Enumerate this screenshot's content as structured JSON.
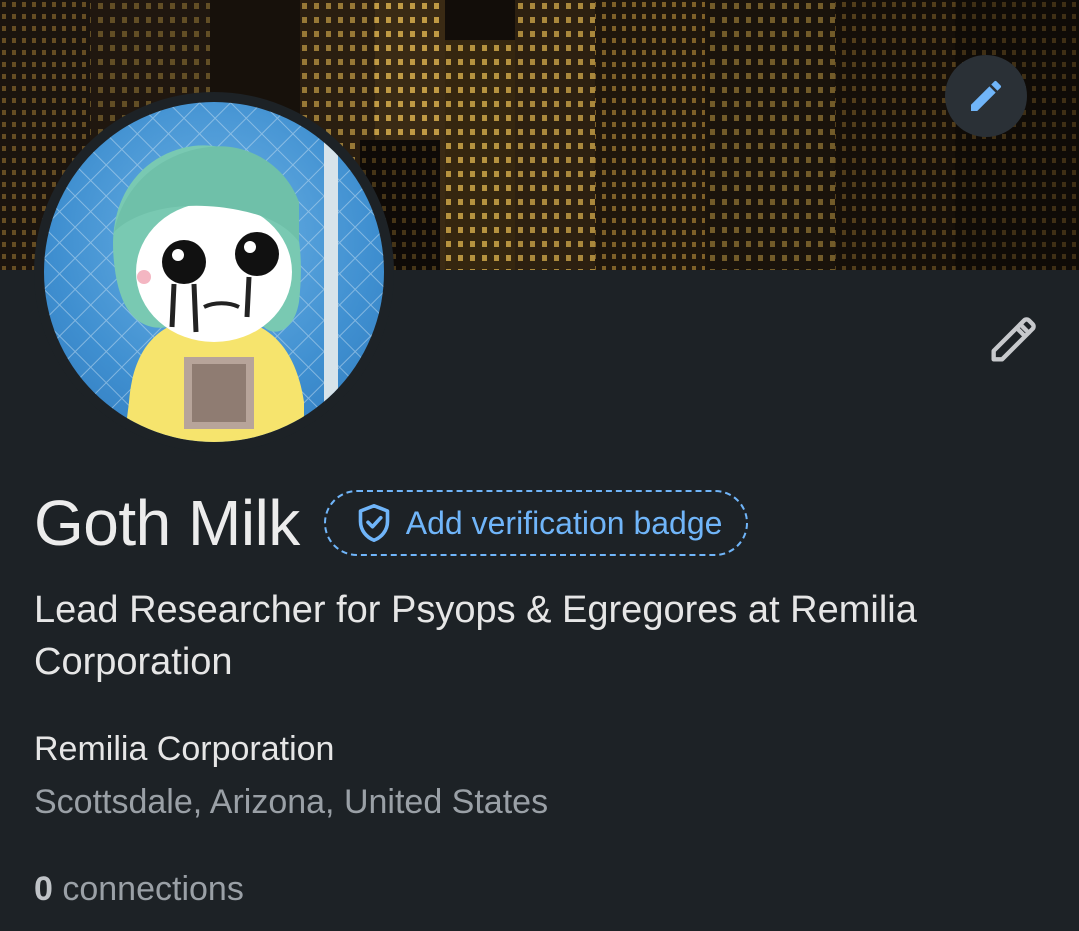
{
  "profile": {
    "name": "Goth Milk",
    "verification_badge_label": "Add verification badge",
    "headline": "Lead Researcher for Psyops & Egregores  at Remilia Corporation",
    "company": "Remilia Corporation",
    "location": "Scottsdale, Arizona, United States",
    "connections_count": "0",
    "connections_label": " connections"
  },
  "icons": {
    "banner_edit": "pencil-icon",
    "profile_edit": "pencil-outline-icon",
    "verification": "shield-check-icon"
  },
  "colors": {
    "background": "#1d2226",
    "accent": "#70b5f9",
    "muted_text": "#9aa0a6"
  }
}
